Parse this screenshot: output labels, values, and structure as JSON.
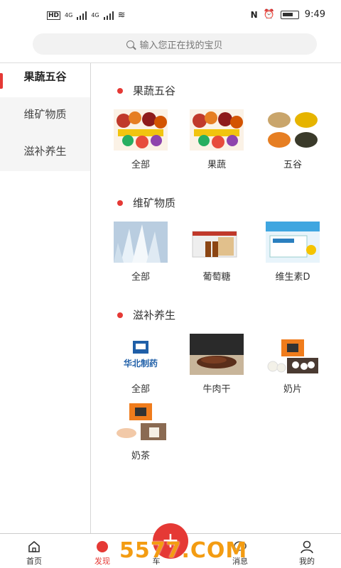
{
  "status_bar": {
    "left": "HD 4G 4G",
    "time": "9:49"
  },
  "search": {
    "placeholder": "输入您正在找的宝贝"
  },
  "sidebar": {
    "items": [
      {
        "label": "果蔬五谷",
        "active": true
      },
      {
        "label": "维矿物质",
        "active": false
      },
      {
        "label": "滋补养生",
        "active": false
      }
    ]
  },
  "sections": [
    {
      "title": "果蔬五谷",
      "items": [
        {
          "label": "全部"
        },
        {
          "label": "果蔬"
        },
        {
          "label": "五谷"
        }
      ]
    },
    {
      "title": "维矿物质",
      "items": [
        {
          "label": "全部"
        },
        {
          "label": "葡萄糖"
        },
        {
          "label": "维生素D"
        }
      ]
    },
    {
      "title": "滋补养生",
      "items": [
        {
          "label": "全部"
        },
        {
          "label": "牛肉干"
        },
        {
          "label": "奶片"
        },
        {
          "label": "奶茶"
        }
      ]
    }
  ],
  "tabbar": {
    "tabs": [
      {
        "label": "首页"
      },
      {
        "label": "发现",
        "active": true
      },
      {
        "label": "车"
      },
      {
        "label": "消息"
      },
      {
        "label": "我的"
      }
    ],
    "fab": "+"
  },
  "watermark": "5577.COM",
  "brand_logo": "华北制药",
  "colors": {
    "accent": "#e53935"
  }
}
